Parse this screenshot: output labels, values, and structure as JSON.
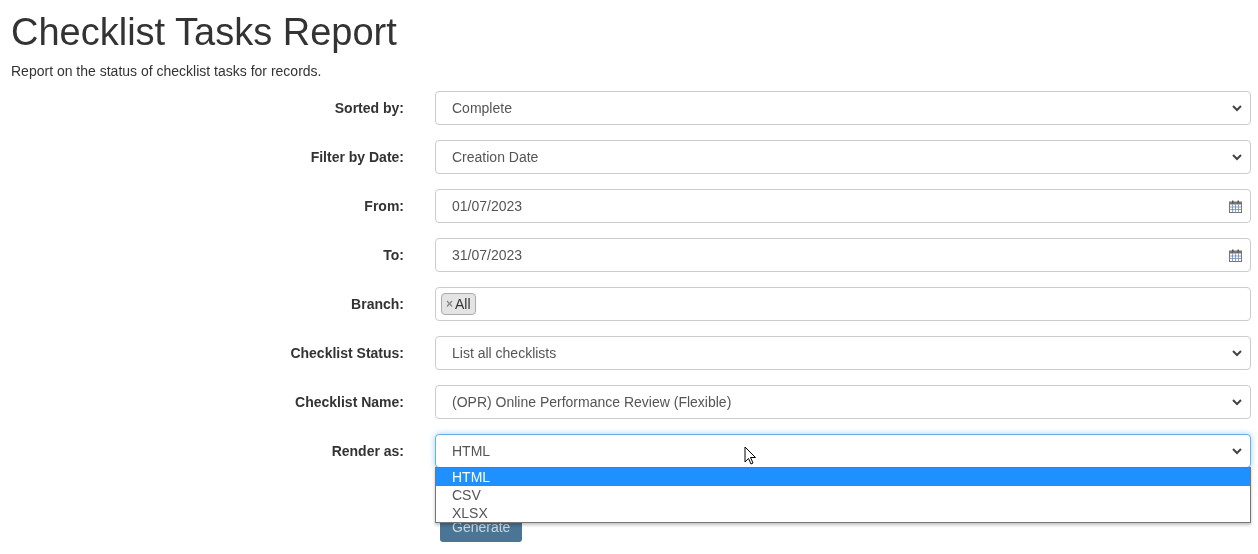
{
  "title": "Checklist Tasks Report",
  "description": "Report on the status of checklist tasks for records.",
  "fields": [
    {
      "label": "Sorted by:",
      "kind": "select",
      "value": "Complete",
      "focused": false
    },
    {
      "label": "Filter by Date:",
      "kind": "select",
      "value": "Creation Date",
      "focused": false
    },
    {
      "label": "From:",
      "kind": "date",
      "value": "01/07/2023",
      "focused": false
    },
    {
      "label": "To:",
      "kind": "date",
      "value": "31/07/2023",
      "focused": false
    },
    {
      "label": "Branch:",
      "kind": "tags",
      "tags": [
        "All"
      ],
      "tag_remove": "×",
      "focused": false
    },
    {
      "label": "Checklist Status:",
      "kind": "select",
      "value": "List all checklists",
      "focused": false
    },
    {
      "label": "Checklist Name:",
      "kind": "select",
      "value": "(OPR) Online Performance Review (Flexible)",
      "focused": false
    },
    {
      "label": "Render as:",
      "kind": "select",
      "value": "HTML",
      "focused": true,
      "expanded": true,
      "options": [
        {
          "label": "HTML",
          "selected": true
        },
        {
          "label": "CSV",
          "selected": false
        },
        {
          "label": "XLSX",
          "selected": false
        }
      ]
    }
  ],
  "button": "Generate"
}
